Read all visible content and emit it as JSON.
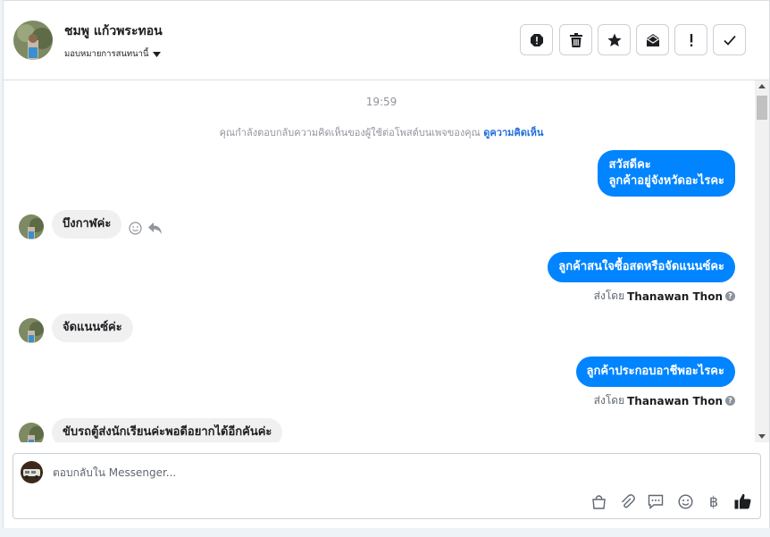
{
  "header": {
    "name": "ชมพู แก้วพระทอน",
    "assign_label": "มอบหมายการสนทนานี้",
    "toolbar": [
      {
        "icon": "spam-icon"
      },
      {
        "icon": "trash-icon"
      },
      {
        "icon": "star-icon"
      },
      {
        "icon": "mark-unread-icon"
      },
      {
        "icon": "follow-up-icon"
      },
      {
        "icon": "done-icon"
      }
    ]
  },
  "conversation": {
    "timestamp": "19:59",
    "notice_text": "คุณกำลังตอบกลับความคิดเห็นของผู้ใช้ต่อโพสต์บนเพจของคุณ",
    "notice_link": "ดูความคิดเห็น",
    "messages": [
      {
        "direction": "out",
        "lines": [
          "สวัสดีคะ",
          "ลูกค้าอยู่จังหวัดอะไรคะ"
        ]
      },
      {
        "direction": "in",
        "text": "บึงกาฬค่ะ"
      },
      {
        "direction": "out",
        "text": "ลูกค้าสนใจซื้อสดหรือจัดแนนซ์คะ",
        "sent_by_prefix": "ส่งโดย",
        "sent_by": "Thanawan Thon"
      },
      {
        "direction": "in",
        "text": "จัดแนนซ์ค่ะ"
      },
      {
        "direction": "out",
        "text": "ลูกค้าประกอบอาชีพอะไรคะ",
        "sent_by_prefix": "ส่งโดย",
        "sent_by": "Thanawan Thon"
      },
      {
        "direction": "in",
        "text": "ขับรถตู้ส่งนักเรียนค่ะพอดีอยากได้อีกคันค่ะ"
      }
    ]
  },
  "composer": {
    "placeholder": "ตอบกลับใน Messenger...",
    "icons": [
      "bag-icon",
      "attachment-icon",
      "saved-reply-icon",
      "emoji-icon",
      "baht-icon",
      "like-icon"
    ]
  },
  "colors": {
    "accent": "#0084ff",
    "link": "#216fdb",
    "incoming_bubble": "#f1f0f0"
  }
}
